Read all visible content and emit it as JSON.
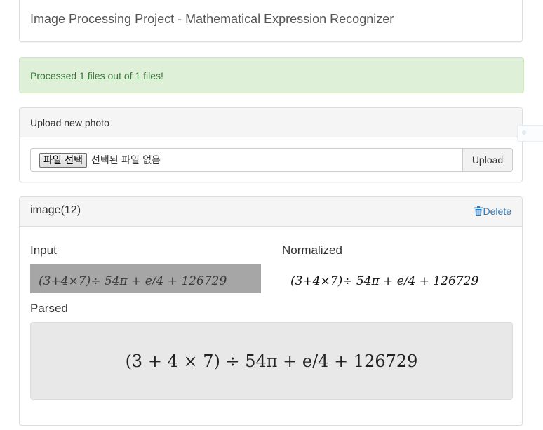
{
  "header": {
    "title": "Image Processing Project - Mathematical Expression Recognizer"
  },
  "alert": {
    "message": "Processed 1 files out of 1 files!"
  },
  "upload": {
    "heading": "Upload new photo",
    "choose_label": "파일 선택",
    "file_status": "선택된 파일 없음",
    "upload_label": "Upload"
  },
  "result": {
    "image_name": "image(12)",
    "delete_label": "Delete",
    "input_label": "Input",
    "normalized_label": "Normalized",
    "parsed_label": "Parsed",
    "handwritten_expression": "(3+4×7)÷ 54π + e/4 + 126729",
    "parsed_expression": "(3 + 4 × 7) ÷ 54π + e/4 + 126729"
  },
  "colors": {
    "alert_bg": "#dff0d8",
    "alert_text": "#3c763d",
    "link": "#337ab7",
    "panel_heading_bg": "#f5f5f5"
  },
  "icons": {
    "delete": "trash-icon"
  }
}
